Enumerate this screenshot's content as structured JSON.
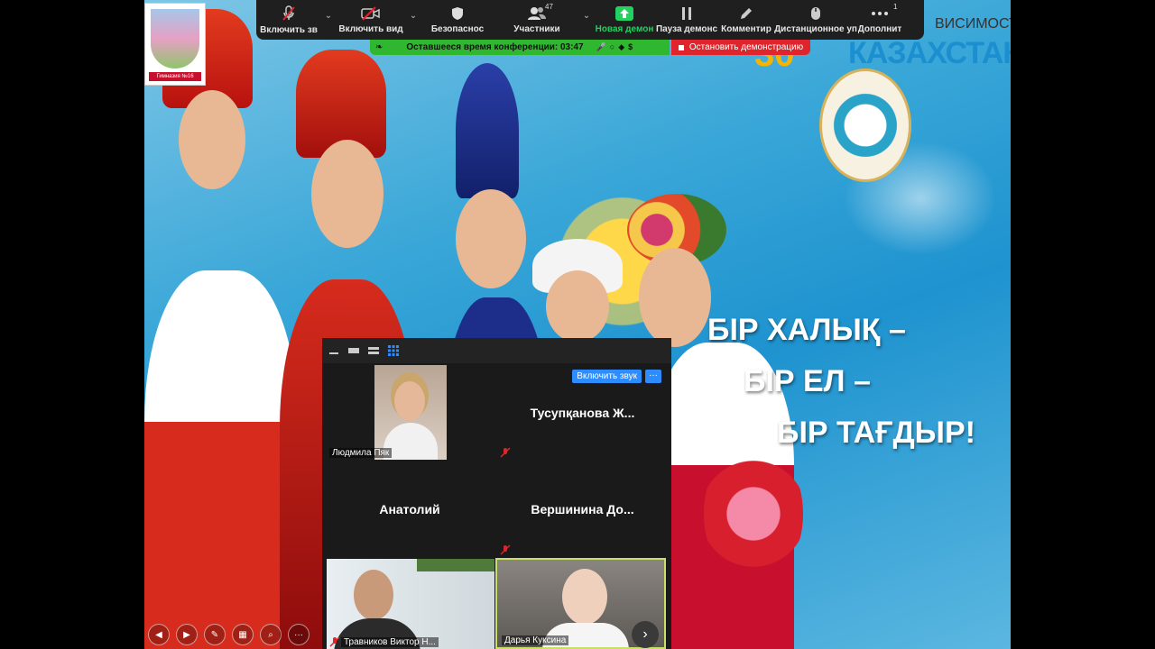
{
  "toolbar": {
    "mute": {
      "label": "Включить зв",
      "icon": "mic-muted-icon"
    },
    "video": {
      "label": "Включить вид",
      "icon": "video-off-icon"
    },
    "security": {
      "label": "Безопаснос",
      "icon": "shield-icon"
    },
    "participants": {
      "label": "Участники",
      "count": "47",
      "icon": "participants-icon"
    },
    "new_share": {
      "label": "Новая демон",
      "icon": "share-up-icon"
    },
    "pause_share": {
      "label": "Пауза демонс",
      "icon": "pause-icon"
    },
    "annotate": {
      "label": "Комментир",
      "icon": "pencil-icon"
    },
    "remote": {
      "label": "Дистанционное уп",
      "icon": "mouse-icon"
    },
    "more": {
      "label": "Дополнит",
      "badge": "1",
      "icon": "more-icon"
    }
  },
  "timer": {
    "text": "Оставшееся время конференции: 03:47"
  },
  "stop_share": {
    "label": "Остановить демонстрацию"
  },
  "slide": {
    "headline": [
      "БІР ХАЛЫҚ –",
      "БІР ЕЛ –",
      "БІР ТАҒДЫР!"
    ],
    "kz_title": "КАЗАХСТАН",
    "kz_subtitle": "ВИСИМОСТИ",
    "kz_number": "30",
    "logo_caption": "Гимназия №16"
  },
  "panel": {
    "unmute_button": "Включить звук",
    "more_button": "···",
    "participants": [
      {
        "name": "Людмила Пяк",
        "has_video": true
      },
      {
        "name": "Тусупқанова Ж...",
        "muted": true
      },
      {
        "name": "Анатолий"
      },
      {
        "name": "Вершинина До...",
        "muted": true
      },
      {
        "name": "Травников Виктор Н...",
        "has_video": true,
        "muted": true
      },
      {
        "name": "Дарья Куксина",
        "has_video": true,
        "active_speaker": true
      }
    ]
  },
  "colors": {
    "toolbar_bg": "#1f1f1f",
    "timer_green": "#2fb82f",
    "stop_red": "#e0242b",
    "zoom_blue": "#2d8cff"
  }
}
